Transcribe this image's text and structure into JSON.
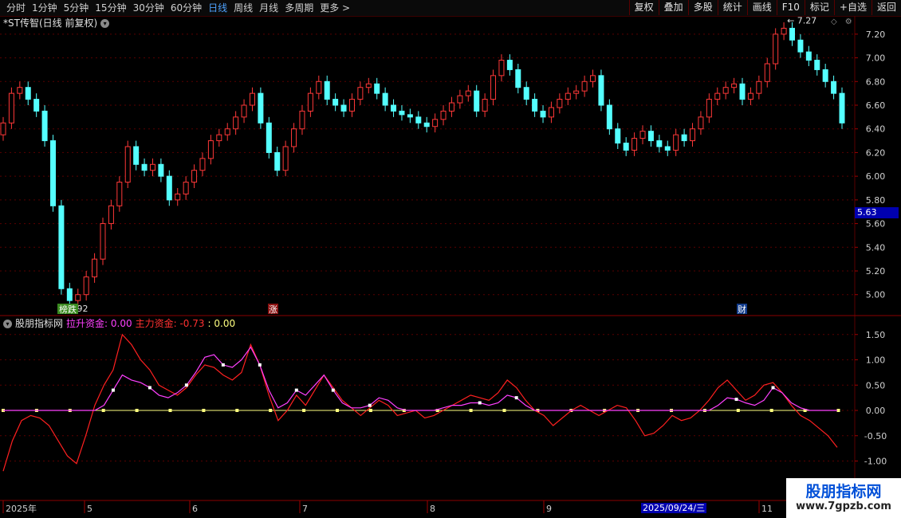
{
  "toolbar": {
    "periods": [
      "分时",
      "1分钟",
      "5分钟",
      "15分钟",
      "30分钟",
      "60分钟",
      "日线",
      "周线",
      "月线",
      "多周期",
      "更多 >"
    ],
    "active_period": "日线",
    "buttons": [
      "复权",
      "叠加",
      "多股",
      "统计",
      "画线",
      "F10",
      "+自选",
      "返回",
      "标记"
    ]
  },
  "stock": {
    "title": "*ST传智(日线 前复权)"
  },
  "price_axis": {
    "labels": [
      "7.20",
      "7.00",
      "6.80",
      "6.60",
      "6.40",
      "6.20",
      "6.00",
      "5.80",
      "5.60",
      "5.40",
      "5.20",
      "5.00"
    ],
    "current": "5.63"
  },
  "annotations": {
    "high": "7.27",
    "low": "4.92",
    "marker_limit_down": "榜跌",
    "marker_limit_up": "涨",
    "marker_finance": "财"
  },
  "indicator": {
    "name": "股朋指标网",
    "line1_label": "拉升资金: 0.00",
    "line2_label": "主力资金: -0.73",
    "line3_label": ": 0.00",
    "axis": [
      "1.50",
      "1.00",
      "0.50",
      "0.00",
      "-0.50",
      "-1.00"
    ]
  },
  "date_axis": {
    "labels": [
      "2025年",
      "5",
      "6",
      "7",
      "8",
      "9",
      "11"
    ],
    "cursor": "2025/09/24/三"
  },
  "watermark": {
    "line1": "股朋指标网",
    "line2": "www.7gpzb.com"
  },
  "colors": {
    "up": "#ff3838",
    "down": "#54ffff",
    "grid": "#5a0000",
    "main_line": "#ff2020",
    "pull_line": "#ff40ff",
    "zero_line": "#ffff80"
  },
  "chart_data": {
    "type": "candlestick",
    "closes": [
      6.45,
      6.7,
      6.75,
      6.65,
      6.55,
      6.3,
      5.75,
      5.05,
      4.95,
      5.0,
      5.15,
      5.3,
      5.6,
      5.75,
      5.95,
      6.25,
      6.1,
      6.05,
      6.1,
      6.0,
      5.8,
      5.85,
      5.95,
      6.05,
      6.15,
      6.3,
      6.35,
      6.4,
      6.5,
      6.6,
      6.7,
      6.45,
      6.2,
      6.05,
      6.25,
      6.4,
      6.55,
      6.7,
      6.8,
      6.65,
      6.6,
      6.55,
      6.65,
      6.75,
      6.78,
      6.7,
      6.6,
      6.55,
      6.52,
      6.5,
      6.45,
      6.42,
      6.48,
      6.55,
      6.62,
      6.68,
      6.72,
      6.55,
      6.65,
      6.85,
      6.98,
      6.9,
      6.75,
      6.65,
      6.55,
      6.5,
      6.58,
      6.65,
      6.7,
      6.72,
      6.8,
      6.85,
      6.6,
      6.4,
      6.28,
      6.22,
      6.32,
      6.38,
      6.3,
      6.25,
      6.22,
      6.35,
      6.3,
      6.4,
      6.5,
      6.65,
      6.7,
      6.75,
      6.78,
      6.65,
      6.7,
      6.8,
      6.95,
      7.2,
      7.25,
      7.15,
      7.05,
      6.98,
      6.9,
      6.8,
      6.7,
      6.45
    ],
    "ylim": [
      4.85,
      7.3
    ],
    "main_force": [
      -1.2,
      -0.6,
      -0.2,
      -0.1,
      -0.15,
      -0.3,
      -0.6,
      -0.9,
      -1.05,
      -0.5,
      0.1,
      0.5,
      0.8,
      1.5,
      1.3,
      1.0,
      0.8,
      0.5,
      0.4,
      0.3,
      0.45,
      0.7,
      0.9,
      0.85,
      0.7,
      0.6,
      0.75,
      1.3,
      0.9,
      0.3,
      -0.2,
      0.0,
      0.3,
      0.1,
      0.4,
      0.7,
      0.45,
      0.2,
      0.05,
      -0.1,
      0.05,
      0.2,
      0.1,
      -0.1,
      -0.05,
      0.0,
      -0.15,
      -0.1,
      0.0,
      0.1,
      0.2,
      0.3,
      0.25,
      0.2,
      0.35,
      0.6,
      0.45,
      0.2,
      0.0,
      -0.1,
      -0.3,
      -0.15,
      0.0,
      0.1,
      0.0,
      -0.1,
      0.0,
      0.1,
      0.05,
      -0.2,
      -0.5,
      -0.45,
      -0.3,
      -0.1,
      -0.2,
      -0.15,
      0.0,
      0.2,
      0.45,
      0.6,
      0.4,
      0.2,
      0.3,
      0.5,
      0.55,
      0.35,
      0.1,
      -0.1,
      -0.2,
      -0.35,
      -0.5,
      -0.73
    ],
    "pull_funds": [
      0.0,
      0.0,
      0.0,
      0.0,
      0.0,
      0.0,
      0.0,
      0.0,
      0.0,
      0.0,
      0.0,
      0.1,
      0.4,
      0.7,
      0.6,
      0.55,
      0.45,
      0.3,
      0.25,
      0.35,
      0.5,
      0.75,
      1.05,
      1.1,
      0.9,
      0.85,
      1.0,
      1.25,
      0.9,
      0.4,
      0.05,
      0.15,
      0.4,
      0.3,
      0.5,
      0.7,
      0.4,
      0.15,
      0.05,
      0.05,
      0.1,
      0.25,
      0.2,
      0.05,
      0.0,
      0.0,
      0.0,
      0.0,
      0.05,
      0.1,
      0.1,
      0.15,
      0.15,
      0.1,
      0.15,
      0.3,
      0.25,
      0.1,
      0.0,
      0.0,
      0.0,
      0.0,
      0.0,
      0.0,
      0.0,
      0.0,
      0.0,
      0.0,
      0.0,
      0.0,
      0.0,
      0.0,
      0.0,
      0.0,
      0.0,
      0.0,
      0.0,
      0.0,
      0.1,
      0.25,
      0.22,
      0.15,
      0.1,
      0.2,
      0.45,
      0.35,
      0.15,
      0.05,
      0.0,
      0.0,
      0.0,
      0.0
    ]
  }
}
